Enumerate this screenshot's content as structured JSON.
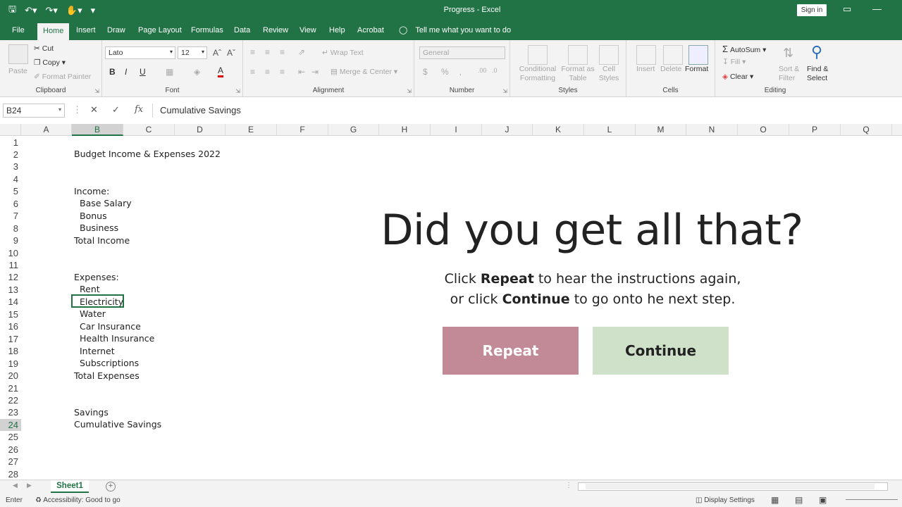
{
  "window": {
    "title": "Progress  -  Excel",
    "sign_in": "Sign in"
  },
  "qat": {
    "save_icon": "save-icon",
    "undo_icon": "undo-icon",
    "redo_icon": "redo-icon",
    "touch_icon": "touch-mode-icon"
  },
  "tabs": [
    "File",
    "Home",
    "Insert",
    "Draw",
    "Page Layout",
    "Formulas",
    "Data",
    "Review",
    "View",
    "Help",
    "Acrobat"
  ],
  "active_tab": "Home",
  "tell_me": "Tell me what you want to do",
  "ribbon": {
    "clipboard": {
      "name": "Clipboard",
      "paste": "Paste",
      "cut": "Cut",
      "copy": "Copy",
      "format_painter": "Format Painter"
    },
    "font": {
      "name": "Font",
      "family": "Lato",
      "size": "12",
      "bold": "B",
      "italic": "I",
      "underline": "U"
    },
    "alignment": {
      "name": "Alignment",
      "wrap": "Wrap Text",
      "merge": "Merge & Center"
    },
    "number": {
      "name": "Number",
      "format": "General"
    },
    "styles": {
      "name": "Styles",
      "conditional": "Conditional Formatting",
      "format_table": "Format as Table",
      "cell_styles": "Cell Styles"
    },
    "cells": {
      "name": "Cells",
      "insert": "Insert",
      "delete": "Delete",
      "format": "Format"
    },
    "editing": {
      "name": "Editing",
      "autosum": "AutoSum",
      "fill": "Fill",
      "clear": "Clear",
      "sort": "Sort & Filter",
      "find": "Find & Select"
    }
  },
  "formula_bar": {
    "name_box": "B24",
    "fx": "fx",
    "value": "Cumulative Savings"
  },
  "columns": [
    "A",
    "B",
    "C",
    "D",
    "E",
    "F",
    "G",
    "H",
    "I",
    "J",
    "K",
    "L",
    "M",
    "N",
    "O",
    "P",
    "Q"
  ],
  "selected_column": "B",
  "rows": [
    "1",
    "2",
    "3",
    "4",
    "5",
    "6",
    "7",
    "8",
    "9",
    "10",
    "11",
    "12",
    "13",
    "14",
    "15",
    "16",
    "17",
    "18",
    "19",
    "20",
    "21",
    "22",
    "23",
    "24",
    "25",
    "26",
    "27",
    "28"
  ],
  "selected_row": "24",
  "cells": [
    {
      "row": 2,
      "text": "Budget Income & Expenses 2022",
      "indent": false
    },
    {
      "row": 5,
      "text": "Income:",
      "indent": false
    },
    {
      "row": 6,
      "text": "Base Salary",
      "indent": true
    },
    {
      "row": 7,
      "text": "Bonus",
      "indent": true
    },
    {
      "row": 8,
      "text": "Business",
      "indent": true
    },
    {
      "row": 9,
      "text": "Total Income",
      "indent": false
    },
    {
      "row": 12,
      "text": "Expenses:",
      "indent": false
    },
    {
      "row": 13,
      "text": "Rent",
      "indent": true
    },
    {
      "row": 14,
      "text": "Electricity",
      "indent": true
    },
    {
      "row": 15,
      "text": "Water",
      "indent": true
    },
    {
      "row": 16,
      "text": "Car Insurance",
      "indent": true
    },
    {
      "row": 17,
      "text": "Health Insurance",
      "indent": true
    },
    {
      "row": 18,
      "text": "Internet",
      "indent": true
    },
    {
      "row": 19,
      "text": "Subscriptions",
      "indent": true
    },
    {
      "row": 20,
      "text": "Total Expenses",
      "indent": false
    },
    {
      "row": 23,
      "text": "Savings",
      "indent": false
    },
    {
      "row": 24,
      "text": "Cumulative Savings",
      "indent": false
    }
  ],
  "overlay": {
    "headline": "Did you get all that?",
    "line1_pre": "Click ",
    "line1_bold": "Repeat",
    "line1_post": " to hear the instructions again,",
    "line2_pre": "or click ",
    "line2_bold": "Continue",
    "line2_post": " to go onto he next step.",
    "repeat": "Repeat",
    "continue": "Continue",
    "repeat_color": "#c28a97",
    "continue_color": "#cfe2c9"
  },
  "sheets": [
    "Sheet1"
  ],
  "status": {
    "mode": "Enter",
    "accessibility": "Accessibility: Good to go",
    "display_settings": "Display Settings"
  },
  "colors": {
    "accent": "#217346"
  }
}
